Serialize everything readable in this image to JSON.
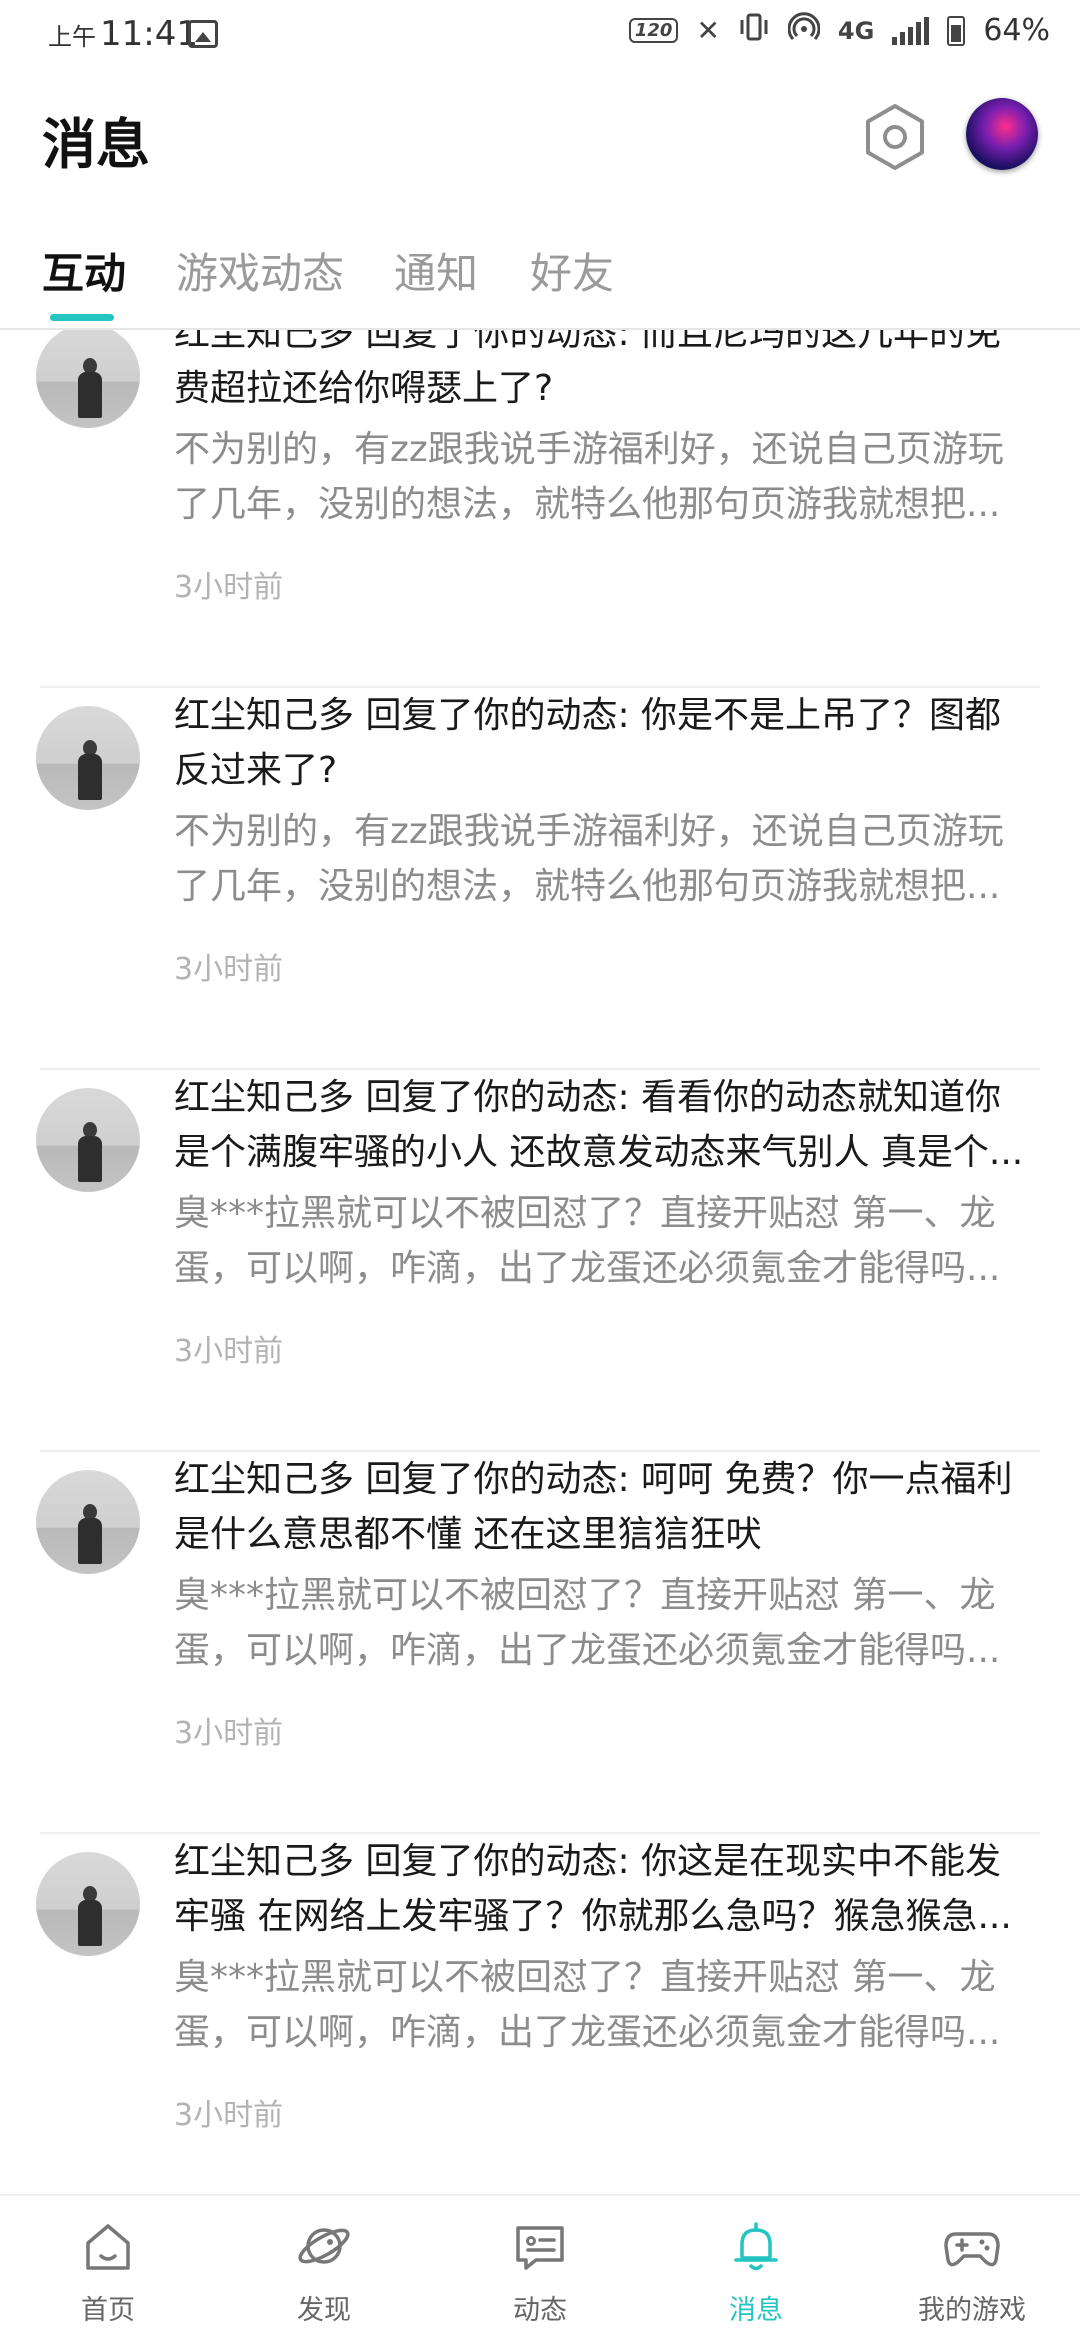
{
  "status_bar": {
    "ampm": "上午",
    "time": "11:41",
    "refresh_rate": "120",
    "network": "4G",
    "battery": "64%"
  },
  "header": {
    "title": "消息"
  },
  "tabs": [
    {
      "label": "互动",
      "active": true
    },
    {
      "label": "游戏动态",
      "active": false
    },
    {
      "label": "通知",
      "active": false
    },
    {
      "label": "好友",
      "active": false
    }
  ],
  "messages": [
    {
      "title": "红尘知己多 回复了你的动态: 而且尼玛的这几年的免费超拉还给你嘚瑟上了?",
      "quote": "不为别的，有zz跟我说手游福利好，还说自己页游玩了几年，没别的想法，就特么他那句页游我就想把...",
      "time": "3小时前"
    },
    {
      "title": "红尘知己多 回复了你的动态: 你是不是上吊了？图都反过来了?",
      "quote": "不为别的，有zz跟我说手游福利好，还说自己页游玩了几年，没别的想法，就特么他那句页游我就想把...",
      "time": "3小时前"
    },
    {
      "title": "红尘知己多 回复了你的动态: 看看你的动态就知道你是个满腹牢骚的小人 还故意发动态来气别人 真是个...",
      "quote": "臭***拉黑就可以不被回怼了？直接开贴怼 第一、龙蛋，可以啊，咋滴，出了龙蛋还必须氪金才能得吗...",
      "time": "3小时前"
    },
    {
      "title": "红尘知己多 回复了你的动态: 呵呵 免费？你一点福利是什么意思都不懂 还在这里狺狺狂吠",
      "quote": "臭***拉黑就可以不被回怼了？直接开贴怼 第一、龙蛋，可以啊，咋滴，出了龙蛋还必须氪金才能得吗...",
      "time": "3小时前"
    },
    {
      "title": "红尘知己多 回复了你的动态: 你这是在现实中不能发牢骚 在网络上发牢骚了？你就那么急吗？猴急猴急...",
      "quote": "臭***拉黑就可以不被回怼了？直接开贴怼 第一、龙蛋，可以啊，咋滴，出了龙蛋还必须氪金才能得吗...",
      "time": "3小时前"
    }
  ],
  "bottom_nav": [
    {
      "label": "首页",
      "icon": "home-icon",
      "active": false
    },
    {
      "label": "发现",
      "icon": "planet-icon",
      "active": false
    },
    {
      "label": "动态",
      "icon": "chat-card-icon",
      "active": false
    },
    {
      "label": "消息",
      "icon": "bell-icon",
      "active": true
    },
    {
      "label": "我的游戏",
      "icon": "gamepad-icon",
      "active": false
    }
  ],
  "colors": {
    "accent": "#23c4c1",
    "text_primary": "#1a1a1a",
    "text_secondary": "#8c8c8c",
    "text_time": "#b3b3b3"
  }
}
